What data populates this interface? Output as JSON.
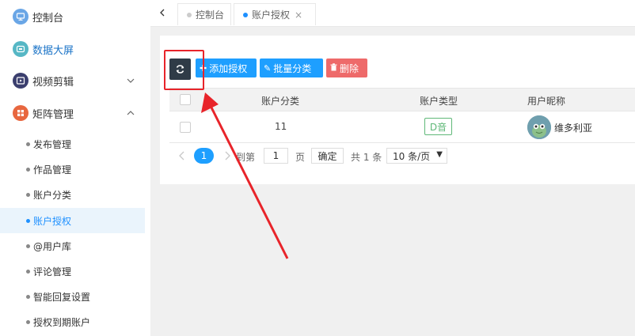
{
  "sidebar": {
    "top_items": [
      {
        "label": "控制台",
        "icon": "monitor-icon",
        "color": "#6aa6e6"
      },
      {
        "label": "数据大屏",
        "icon": "screen-icon",
        "color": "#56b7c5"
      },
      {
        "label": "视频剪辑",
        "icon": "video-icon",
        "color": "#3b3f6e"
      },
      {
        "label": "矩阵管理",
        "icon": "grid-icon",
        "color": "#e8673f"
      }
    ],
    "sub_items": [
      {
        "label": "发布管理"
      },
      {
        "label": "作品管理"
      },
      {
        "label": "账户分类"
      },
      {
        "label": "账户授权"
      },
      {
        "label": "@用户库"
      },
      {
        "label": "评论管理"
      },
      {
        "label": "智能回复设置"
      },
      {
        "label": "授权到期账户"
      }
    ]
  },
  "tabs": [
    {
      "label": "控制台",
      "dot_color": "#cccccc"
    },
    {
      "label": "账户授权",
      "dot_color": "#1e90ff",
      "close": "×"
    }
  ],
  "toolbar": {
    "add_label": "添加授权",
    "batch_label": "批量分类",
    "delete_label": "删除"
  },
  "table": {
    "headers": [
      "账户分类",
      "账户类型",
      "用户昵称"
    ],
    "rows": [
      {
        "category": "11",
        "type": "D音",
        "nickname": "维多利亚"
      }
    ]
  },
  "pagination": {
    "current": "1",
    "goto_prefix": "到第",
    "goto_value": "1",
    "goto_suffix": "页",
    "confirm": "确定",
    "total": "共 1 条",
    "page_size": "10 条/页"
  },
  "colors": {
    "accent": "#1e9fff",
    "danger": "#ee6a6a",
    "refresh": "#2f3b47",
    "annotation": "#e8242a",
    "tag": "#5fb878"
  }
}
